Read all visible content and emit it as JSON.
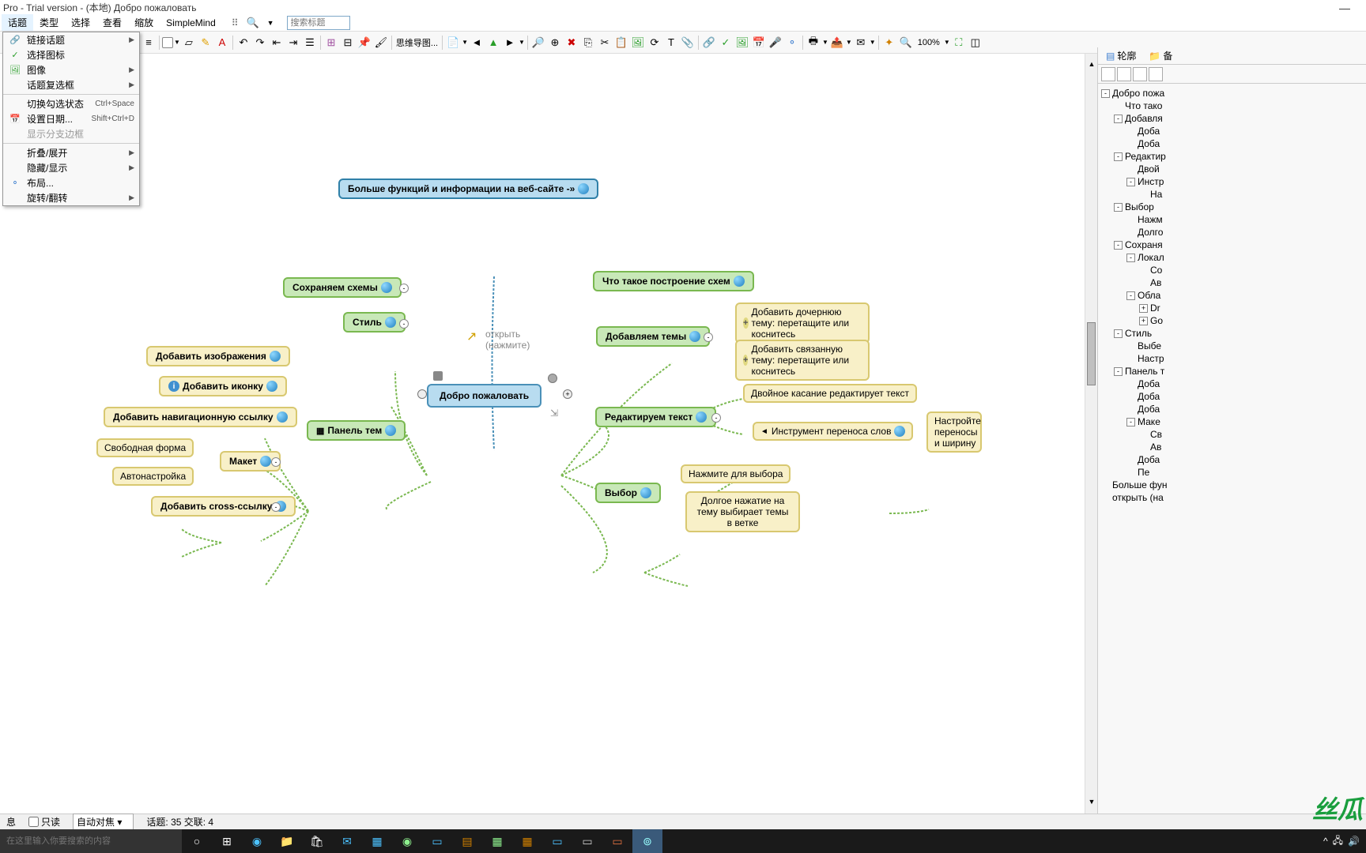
{
  "title": "Pro - Trial version - (本地) Добро пожаловать",
  "menubar": [
    "话题",
    "类型",
    "选择",
    "查看",
    "缩放",
    "SimpleMind"
  ],
  "search_placeholder": "搜索标题",
  "zoom_level": "100%",
  "dropdown": {
    "items": [
      {
        "icon": "🔗",
        "label": "链接话题",
        "arrow": true
      },
      {
        "icon": "✓",
        "label": "选择图标",
        "iconColor": "#2a9e2a"
      },
      {
        "icon": "🖼",
        "label": "图像",
        "arrow": true,
        "iconColor": "#2a9e2a"
      },
      {
        "icon": "",
        "label": "话题复选框",
        "arrow": true
      },
      {
        "sep": true
      },
      {
        "icon": "",
        "label": "切换勾选状态",
        "shortcut": "Ctrl+Space"
      },
      {
        "icon": "📅",
        "label": "设置日期...",
        "shortcut": "Shift+Ctrl+D"
      },
      {
        "icon": "",
        "label": "显示分支边框",
        "disabled": true
      },
      {
        "sep": true
      },
      {
        "icon": "",
        "label": "折叠/展开",
        "arrow": true
      },
      {
        "icon": "",
        "label": "隐藏/显示",
        "arrow": true
      },
      {
        "icon": "⚬",
        "label": "布局...",
        "iconColor": "#4080d0"
      },
      {
        "icon": "",
        "label": "旋转/翻转",
        "arrow": true
      }
    ]
  },
  "mindmap": {
    "center": "Добро пожаловать",
    "top_banner": "Больше функций и информации на веб-сайте -»",
    "open_hint_1": "открыть",
    "open_hint_2": "(нажмите)",
    "nodes": {
      "save_schemes": "Сохраняем схемы",
      "style": "Стиль",
      "add_images": "Добавить изображения",
      "add_icon": "Добавить иконку",
      "add_nav_link": "Добавить навигационную ссылку",
      "themes_panel": "Панель тем",
      "free_form": "Свободная форма",
      "auto_tune": "Автонастройка",
      "layout": "Макет",
      "add_cross": "Добавить cross-ссылку",
      "what_is": "Что такое построение схем",
      "add_themes": "Добавляем темы",
      "add_child": "Добавить дочернюю тему: перетащите или коснитесь",
      "add_related": "Добавить связанную тему: перетащите или коснитесь",
      "edit_text": "Редактируем текст",
      "double_tap": "Двойное касание редактирует текст",
      "word_wrap": "Инструмент переноса слов",
      "wrap_config": "Настройте переносы и ширину",
      "selection": "Выбор",
      "click_select": "Нажмите для выбора",
      "long_press": "Долгое нажатие на тему выбирает темы в ветке"
    }
  },
  "side": {
    "tab_outline": "轮廓",
    "tab_other": "备",
    "items": [
      {
        "t": "Добро пожа",
        "l": 0,
        "exp": "-"
      },
      {
        "t": "Что тако",
        "l": 1
      },
      {
        "t": "Добавля",
        "l": 1,
        "exp": "-"
      },
      {
        "t": "Доба",
        "l": 2
      },
      {
        "t": "Доба",
        "l": 2
      },
      {
        "t": "Редактир",
        "l": 1,
        "exp": "-"
      },
      {
        "t": "Двой",
        "l": 2
      },
      {
        "t": "Инстр",
        "l": 2,
        "exp": "-"
      },
      {
        "t": "На",
        "l": 3
      },
      {
        "t": "Выбор",
        "l": 1,
        "exp": "-"
      },
      {
        "t": "Нажм",
        "l": 2
      },
      {
        "t": "Долго",
        "l": 2
      },
      {
        "t": "Сохраня",
        "l": 1,
        "exp": "-"
      },
      {
        "t": "Локал",
        "l": 2,
        "exp": "-"
      },
      {
        "t": "Со",
        "l": 3
      },
      {
        "t": "Ав",
        "l": 3
      },
      {
        "t": "Обла",
        "l": 2,
        "exp": "-"
      },
      {
        "t": "Dr",
        "l": 3,
        "exp": "+"
      },
      {
        "t": "Go",
        "l": 3,
        "exp": "+"
      },
      {
        "t": "Стиль",
        "l": 1,
        "exp": "-"
      },
      {
        "t": "Выбе",
        "l": 2
      },
      {
        "t": "Настр",
        "l": 2
      },
      {
        "t": "Панель т",
        "l": 1,
        "exp": "-"
      },
      {
        "t": "Доба",
        "l": 2
      },
      {
        "t": "Доба",
        "l": 2
      },
      {
        "t": "Доба",
        "l": 2
      },
      {
        "t": "Маке",
        "l": 2,
        "exp": "-"
      },
      {
        "t": "Св",
        "l": 3
      },
      {
        "t": "Ав",
        "l": 3
      },
      {
        "t": "Доба",
        "l": 2
      },
      {
        "t": "Пе",
        "l": 2
      },
      {
        "t": "Больше фун",
        "l": 0
      },
      {
        "t": "открыть (на",
        "l": 0
      }
    ]
  },
  "statusbar": {
    "msg": "息",
    "readonly": "只读",
    "autofocus": "自动对焦",
    "topics": "话题: 35 交联: 4"
  },
  "taskbar": {
    "search_placeholder": "在这里输入你要搜索的内容"
  },
  "watermark": "丝瓜"
}
